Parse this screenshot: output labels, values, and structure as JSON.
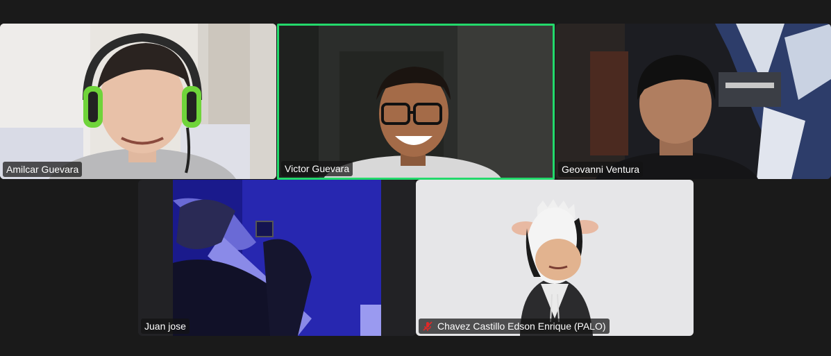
{
  "participants": [
    {
      "name": "Amilcar Guevara",
      "muted": false,
      "active": false
    },
    {
      "name": "Victor Guevara",
      "muted": false,
      "active": true
    },
    {
      "name": "Geovanni Ventura",
      "muted": false,
      "active": false
    },
    {
      "name": "Juan jose",
      "muted": false,
      "active": false
    },
    {
      "name": "Chavez Castillo Edson Enrique (PALO)",
      "muted": true,
      "active": false
    }
  ],
  "colors": {
    "background": "#1a1a1a",
    "active_speaker_border": "#23d96b",
    "muted_icon": "#e02828"
  },
  "icons": {
    "muted": "microphone-muted-icon"
  }
}
